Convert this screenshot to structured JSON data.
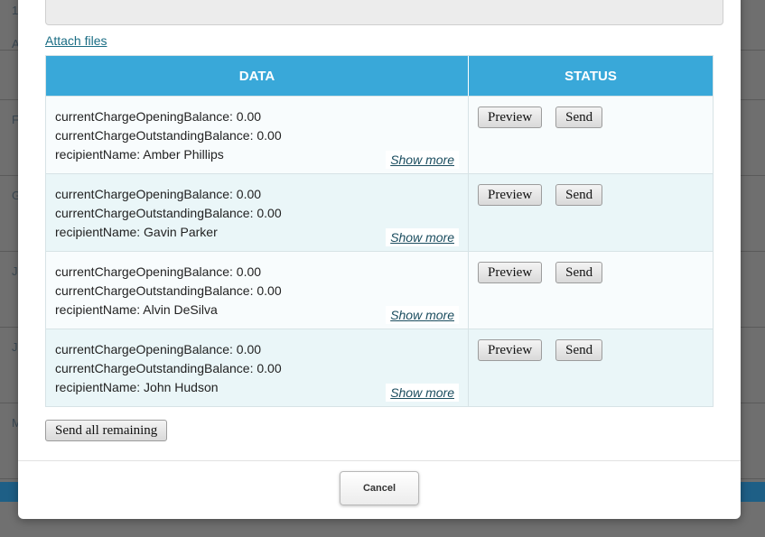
{
  "background": {
    "row_initials": [
      "1",
      "A",
      "F",
      "G",
      "J",
      "J",
      "M"
    ]
  },
  "modal": {
    "attach_link": "Attach files",
    "table": {
      "headers": {
        "data": "DATA",
        "status": "STATUS"
      },
      "rows": [
        {
          "lines": [
            "currentChargeOpeningBalance: 0.00",
            "currentChargeOutstandingBalance: 0.00",
            "recipientName: Amber Phillips"
          ],
          "show_more": "Show more",
          "preview_label": "Preview",
          "send_label": "Send"
        },
        {
          "lines": [
            "currentChargeOpeningBalance: 0.00",
            "currentChargeOutstandingBalance: 0.00",
            "recipientName: Gavin Parker"
          ],
          "show_more": "Show more",
          "preview_label": "Preview",
          "send_label": "Send"
        },
        {
          "lines": [
            "currentChargeOpeningBalance: 0.00",
            "currentChargeOutstandingBalance: 0.00",
            "recipientName: Alvin DeSilva"
          ],
          "show_more": "Show more",
          "preview_label": "Preview",
          "send_label": "Send"
        },
        {
          "lines": [
            "currentChargeOpeningBalance: 0.00",
            "currentChargeOutstandingBalance: 0.00",
            "recipientName: John Hudson"
          ],
          "show_more": "Show more",
          "preview_label": "Preview",
          "send_label": "Send"
        }
      ]
    },
    "send_all_label": "Send all remaining",
    "cancel_label": "Cancel"
  },
  "colors": {
    "header_bg": "#39a8d9",
    "link": "#1a6d84",
    "row_alt": "#eaf6f8"
  }
}
